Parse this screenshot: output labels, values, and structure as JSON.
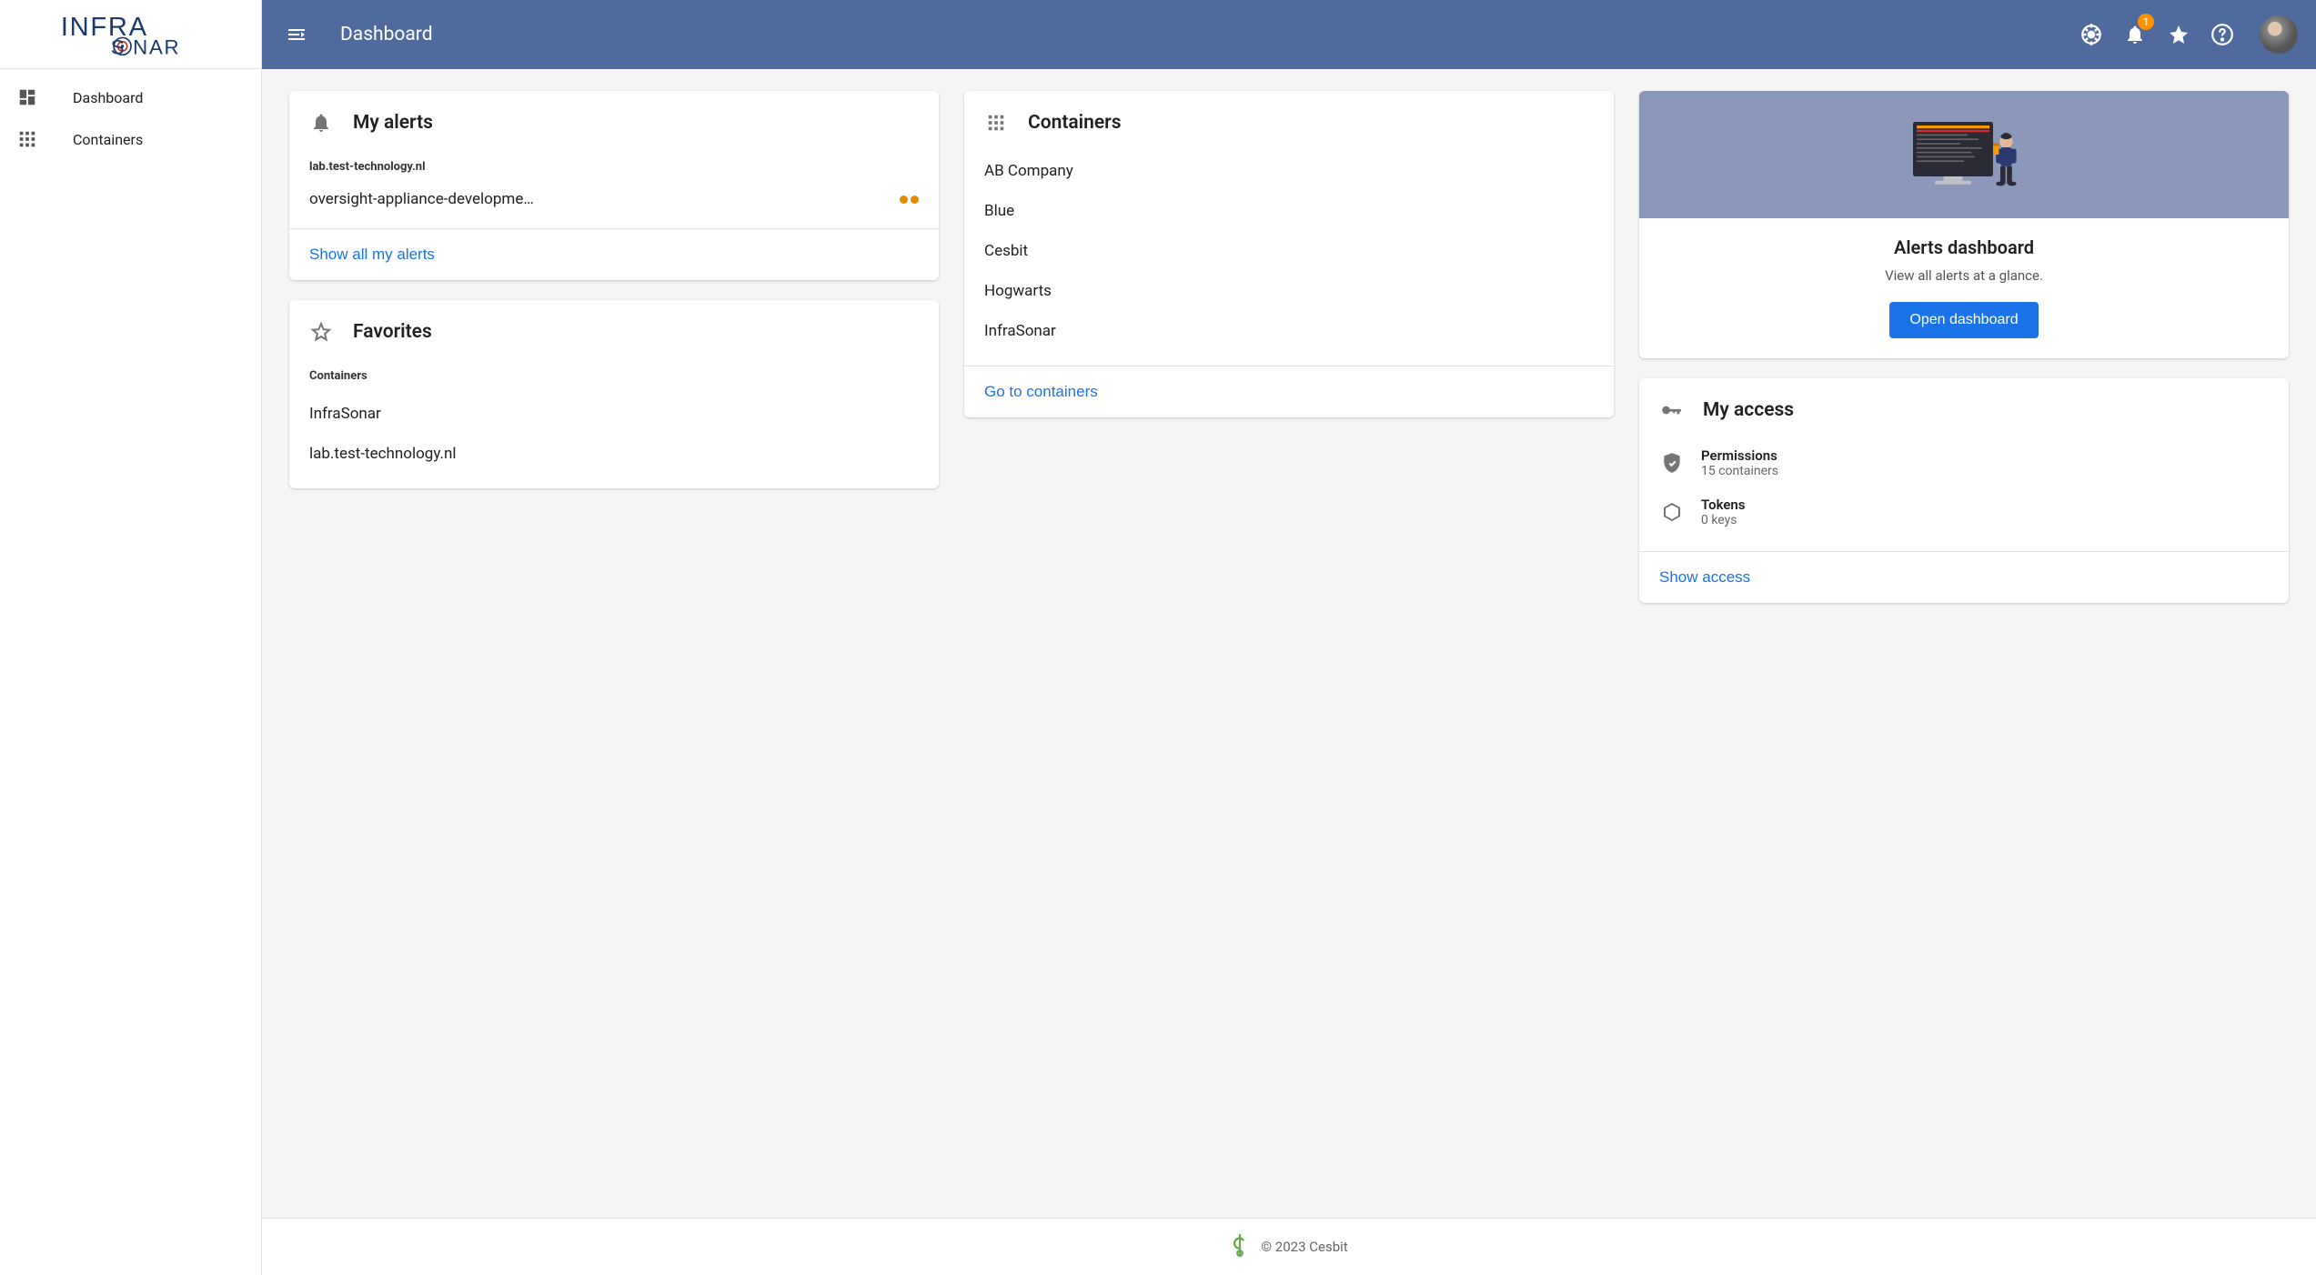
{
  "brand": {
    "name": "INFRA SONAR"
  },
  "header": {
    "title": "Dashboard",
    "notification_count": "1"
  },
  "sidebar": {
    "items": [
      {
        "label": "Dashboard"
      },
      {
        "label": "Containers"
      }
    ]
  },
  "alerts_card": {
    "title": "My alerts",
    "groups": [
      {
        "name": "lab.test-technology.nl",
        "items": [
          {
            "text": "oversight-appliance-developme…",
            "severity_dots": 2
          }
        ]
      }
    ],
    "footer_link": "Show all my alerts"
  },
  "favorites_card": {
    "title": "Favorites",
    "section_label": "Containers",
    "items": [
      {
        "name": "InfraSonar"
      },
      {
        "name": "lab.test-technology.nl"
      }
    ]
  },
  "containers_card": {
    "title": "Containers",
    "items": [
      {
        "name": "AB Company"
      },
      {
        "name": "Blue"
      },
      {
        "name": "Cesbit"
      },
      {
        "name": "Hogwarts"
      },
      {
        "name": "InfraSonar"
      }
    ],
    "footer_link": "Go to containers"
  },
  "promo_card": {
    "title": "Alerts dashboard",
    "subtitle": "View all alerts at a glance.",
    "button": "Open dashboard"
  },
  "access_card": {
    "title": "My access",
    "permissions_label": "Permissions",
    "permissions_value": "15 containers",
    "tokens_label": "Tokens",
    "tokens_value": "0 keys",
    "footer_link": "Show access"
  },
  "footer": {
    "copyright": "© 2023 Cesbit"
  }
}
